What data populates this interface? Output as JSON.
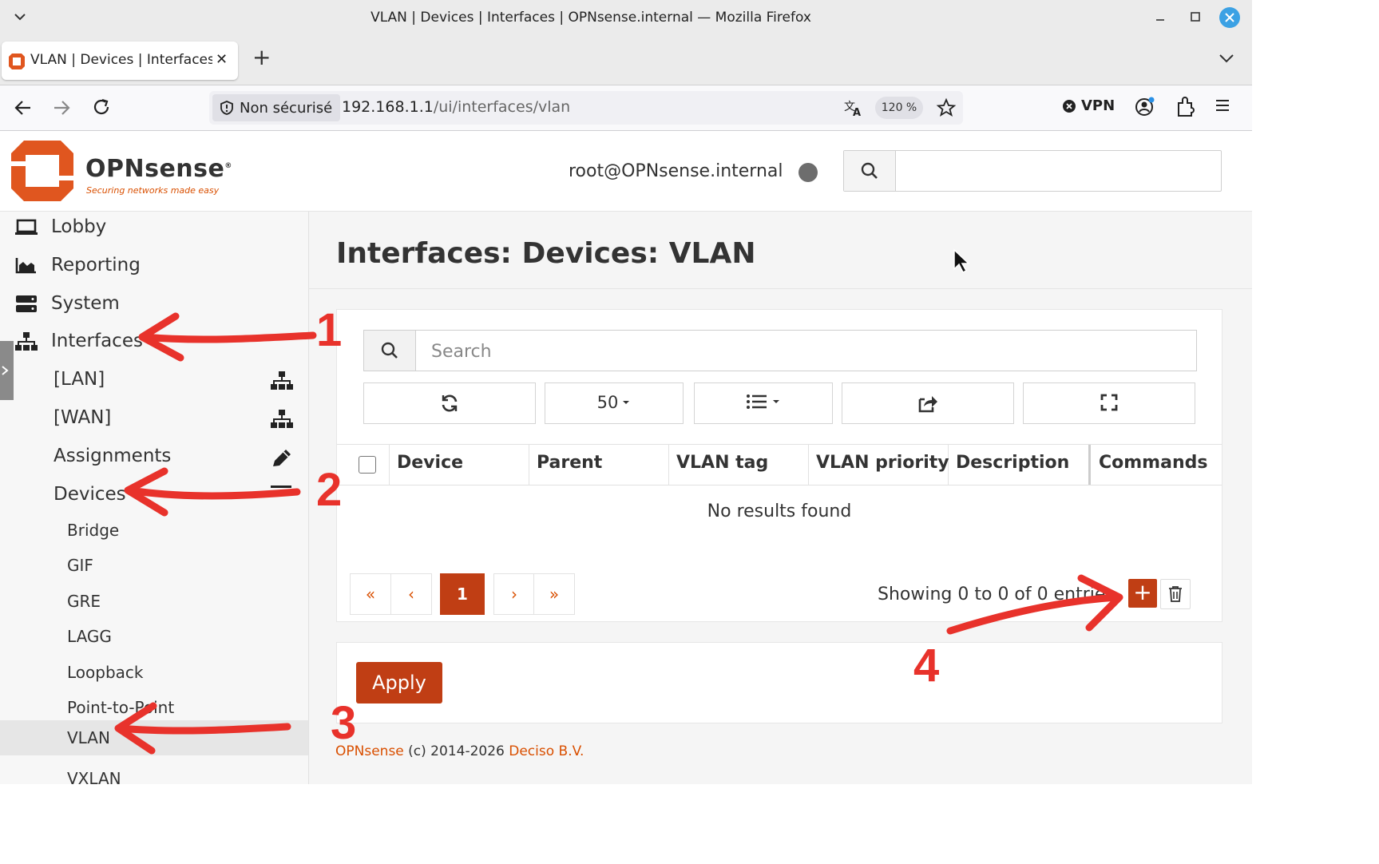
{
  "browser": {
    "window_title": "VLAN | Devices | Interfaces | OPNsense.internal — Mozilla Firefox",
    "tab_title": "VLAN | Devices | Interfaces |",
    "security_label": "Non sécurisé",
    "url_host": "192.168.1.1",
    "url_path": "/ui/interfaces/vlan",
    "zoom": "120 %",
    "vpn_label": "VPN"
  },
  "header": {
    "brand": "OPNsense",
    "brand_mark": "®",
    "tagline": "Securing networks made easy",
    "user_host": "root@OPNsense.internal"
  },
  "sidebar": {
    "items": [
      {
        "label": "Lobby",
        "icon": "laptop-icon"
      },
      {
        "label": "Reporting",
        "icon": "area-chart-icon"
      },
      {
        "label": "System",
        "icon": "server-icon"
      },
      {
        "label": "Interfaces",
        "icon": "sitemap-icon"
      }
    ],
    "interface_subitems": [
      {
        "label": "[LAN]",
        "icon": "sitemap-icon"
      },
      {
        "label": "[WAN]",
        "icon": "sitemap-icon"
      },
      {
        "label": "Assignments",
        "icon": "pencil-icon"
      },
      {
        "label": "Devices",
        "icon": "list-icon"
      }
    ],
    "device_subitems": [
      "Bridge",
      "GIF",
      "GRE",
      "LAGG",
      "Loopback",
      "Point-to-Point",
      "VLAN",
      "VXLAN"
    ],
    "active_item": "VLAN"
  },
  "main": {
    "page_title": "Interfaces: Devices: VLAN",
    "search_placeholder": "Search",
    "page_size": "50",
    "columns": [
      "Device",
      "Parent",
      "VLAN tag",
      "VLAN priority",
      "Description",
      "Commands"
    ],
    "empty_message": "No results found",
    "pager": {
      "first": "«",
      "prev": "‹",
      "current": "1",
      "next": "›",
      "last": "»"
    },
    "showing": "Showing 0 to 0 of 0 entries",
    "add_label": "+",
    "apply_label": "Apply"
  },
  "footer": {
    "brand_link": "OPNsense",
    "copyright": " (c) 2014-2026 ",
    "company_link": "Deciso B.V."
  },
  "annotations": [
    "1",
    "2",
    "3",
    "4"
  ],
  "colors": {
    "accent": "#c03e14",
    "brand_orange": "#d94f00",
    "annotation_red": "#e8322b",
    "sidebar_bg": "#f7f7f7",
    "status_dot": "#6d6d6d"
  }
}
